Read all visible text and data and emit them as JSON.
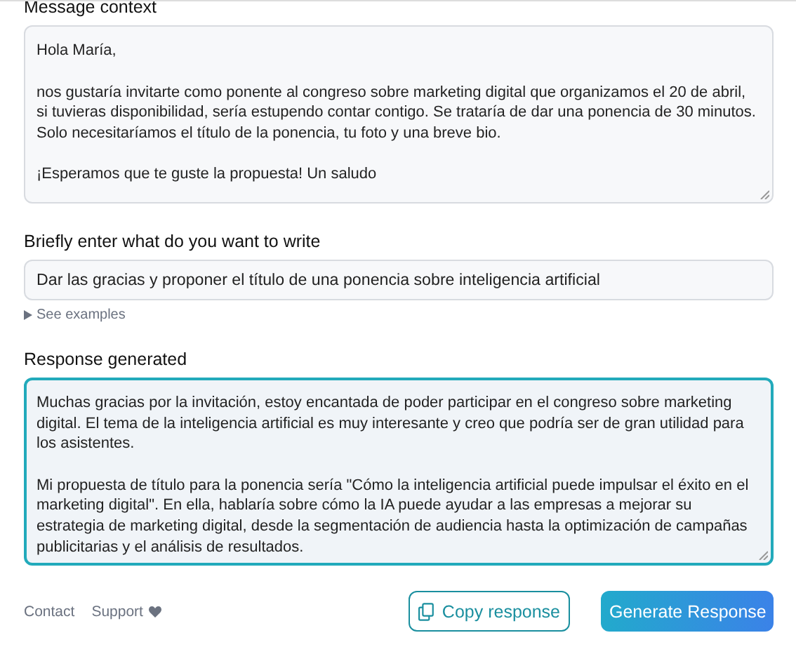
{
  "context": {
    "label": "Message context",
    "paragraphs": [
      "Hola María,",
      "nos gustaría invitarte como ponente al congreso sobre marketing digital que organizamos el 20 de abril, si tuvieras disponibilidad, sería estupendo contar contigo. Se trataría de dar una ponencia de 30 minutos. Solo necesitaríamos el título de la ponencia, tu foto y una breve bio.",
      "¡Esperamos que te guste la propuesta! Un saludo"
    ]
  },
  "prompt": {
    "label": "Briefly enter what do you want to write",
    "value": "Dar las gracias y proponer el título de una ponencia sobre inteligencia artificial",
    "examples": {
      "label": "See examples",
      "expanded": false
    }
  },
  "response": {
    "label": "Response generated",
    "focused": true,
    "paragraphs": [
      "Muchas gracias por la invitación, estoy encantada de poder participar en el congreso sobre marketing digital. El tema de la inteligencia artificial es muy interesante y creo que podría ser de gran utilidad para los asistentes.",
      "Mi propuesta de título para la ponencia sería \"Cómo la inteligencia artificial puede impulsar el éxito en el marketing digital\". En ella, hablaría sobre cómo la IA puede ayudar a las empresas a mejorar su estrategia de marketing digital, desde la segmentación de audiencia hasta la optimización de campañas publicitarias y el análisis de resultados."
    ]
  },
  "footer": {
    "links": [
      "Contact",
      "Support"
    ],
    "copy_button": "Copy response",
    "generate_button": "Generate Response"
  }
}
